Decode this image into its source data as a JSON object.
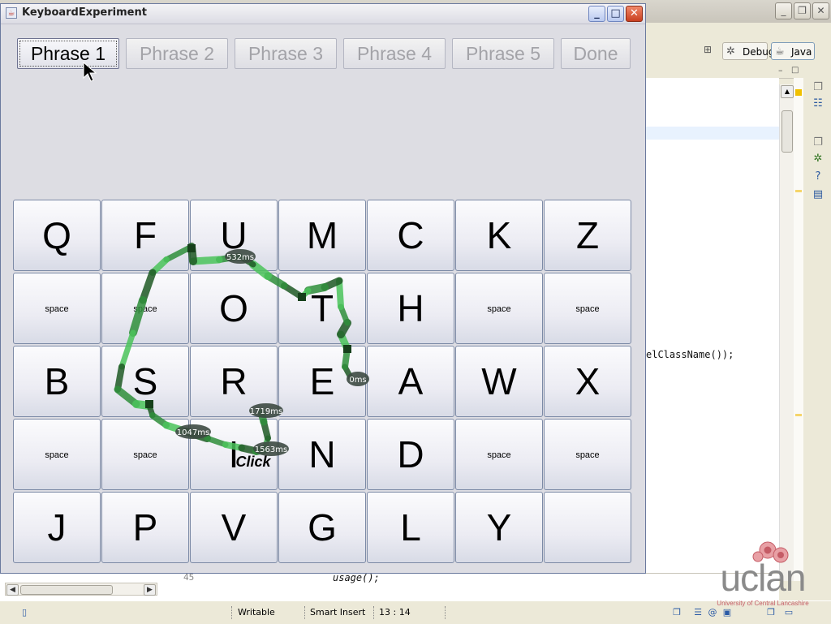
{
  "window": {
    "title": "KeyboardExperiment"
  },
  "window_controls": {
    "minimize": "_",
    "maximize": "□",
    "close": "✕"
  },
  "phrases": [
    {
      "label": "Phrase 1",
      "active": true
    },
    {
      "label": "Phrase 2",
      "active": false
    },
    {
      "label": "Phrase 3",
      "active": false
    },
    {
      "label": "Phrase 4",
      "active": false
    },
    {
      "label": "Phrase 5",
      "active": false
    },
    {
      "label": "Done",
      "active": false
    }
  ],
  "keyboard": {
    "rows": [
      [
        "Q",
        "F",
        "U",
        "M",
        "C",
        "K",
        "Z"
      ],
      [
        "space",
        "space",
        "O",
        "T",
        "H",
        "space",
        "space"
      ],
      [
        "B",
        "S",
        "R",
        "E",
        "A",
        "W",
        "X"
      ],
      [
        "space",
        "space",
        "I",
        "",
        "N",
        "D",
        "space",
        "space"
      ],
      [
        "J",
        "P",
        "V",
        "G",
        "L",
        "Y",
        ""
      ]
    ]
  },
  "trace": {
    "timestamps": [
      "0ms",
      "532ms",
      "1047ms",
      "1563ms",
      "1719ms"
    ],
    "click_label": "Click"
  },
  "eclipse": {
    "perspectives": [
      {
        "label": "Debug",
        "icon": "debug-icon"
      },
      {
        "label": "Java",
        "icon": "java-icon"
      }
    ],
    "code_fragment": "elClassName());",
    "code_bottom_line_number": "45",
    "code_bottom_text": "usage();",
    "status": {
      "writable": "Writable",
      "insert_mode": "Smart Insert",
      "position": "13 : 14"
    }
  },
  "logo": {
    "text": "uclan",
    "subtitle": "University of Central Lancashire"
  },
  "colors": {
    "trace_dark": "#1f5a25",
    "trace_light": "#4bc45b",
    "trace_mid": "#2f8f3b",
    "bubble": "#3d4a42"
  }
}
